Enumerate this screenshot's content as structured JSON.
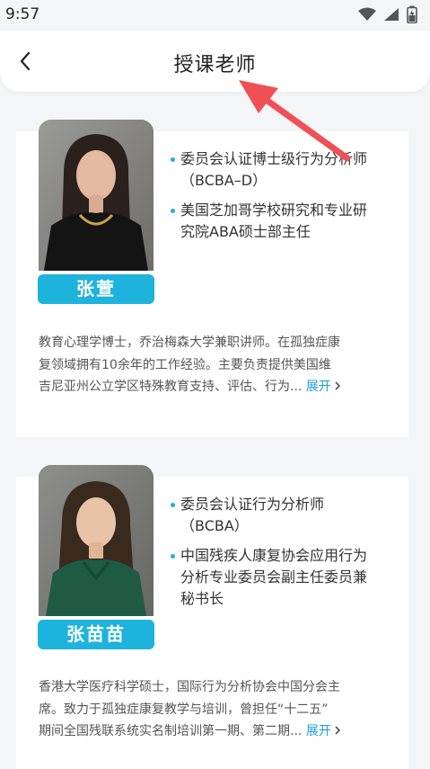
{
  "status": {
    "time": "9:57"
  },
  "header": {
    "title": "授课老师"
  },
  "teachers": [
    {
      "name": "张萱",
      "credentials": [
        "委员会认证博士级行为分析师（BCBA–D）",
        "美国芝加哥学校研究和专业研究院ABA硕士部主任"
      ],
      "cred_lines": [
        [
          "委员会认证博士级行为分析师",
          "（BCBA–D）"
        ],
        [
          "美国芝加哥学校研究和专业研",
          "究院ABA硕士部主任"
        ]
      ],
      "bio_lines": [
        "教育心理学博士，乔治梅森大学兼职讲师。在孤独症康",
        "复领域拥有10余年的工作经验。主要负责提供美国维",
        "吉尼亚州公立学区特殊教育支持、评估、行为..."
      ],
      "expand_label": "展开"
    },
    {
      "name": "张苗苗",
      "credentials": [
        "委员会认证行为分析师（BCBA）",
        "中国残疾人康复协会应用行为分析专业委员会副主任委员兼秘书长"
      ],
      "cred_lines": [
        [
          "委员会认证行为分析师",
          "（BCBA）"
        ],
        [
          "中国残疾人康复协会应用行为",
          "分析专业委员会副主任委员兼",
          "秘书长"
        ]
      ],
      "bio_lines": [
        "香港大学医疗科学硕士，国际行为分析协会中国分会主",
        "席。致力于孤独症康复教学与培训，曾担任“十二五”",
        "期间全国残联系统实名制培训第一期、第二期..."
      ],
      "expand_label": "展开"
    }
  ],
  "colors": {
    "accent": "#1db3dc",
    "link": "#1a9fd4",
    "annotation_arrow": "#ef4f55"
  },
  "icons": [
    "wifi-icon",
    "signal-icon",
    "battery-icon",
    "back-arrow-icon",
    "chevron-right-icon"
  ]
}
